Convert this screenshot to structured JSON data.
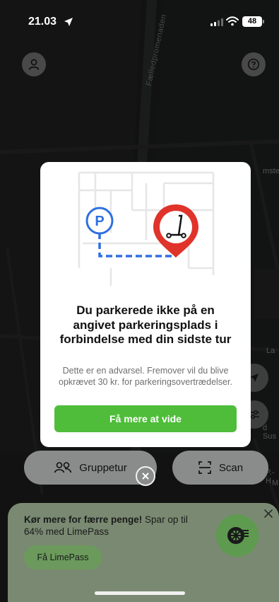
{
  "status_bar": {
    "time": "21.03",
    "battery": "48"
  },
  "map": {
    "street_name": "Fælledpromenaden",
    "labels": [
      "msted",
      "La",
      "d Sus",
      "P.-H",
      "M"
    ]
  },
  "modal": {
    "title": "Du parkerede ikke på en angivet parkeringsplads i forbindelse med din sidste tur",
    "body": "Dette er en advarsel. Fremover vil du blive opkrævet 30 kr. for parkeringsovertrædelser.",
    "cta_label": "Få mere at vide",
    "illustration_letter": "P"
  },
  "actions": {
    "group_ride_label": "Gruppetur",
    "scan_label": "Scan"
  },
  "limepass": {
    "headline_bold": "Kør mere for færre penge!",
    "headline_rest": " Spar op til 64% med LimePass",
    "button_label": "Få LimePass"
  },
  "colors": {
    "accent_green": "#4fbd3a",
    "marker_red": "#e0332a",
    "parking_blue": "#2f6fe0"
  },
  "icons": [
    "location-arrow-icon",
    "signal-icon",
    "wifi-icon",
    "profile-icon",
    "help-icon",
    "navigation-icon",
    "filter-icon",
    "group-icon",
    "scan-icon",
    "close-icon",
    "wheel-icon"
  ]
}
